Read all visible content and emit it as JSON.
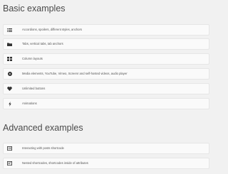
{
  "colors": {
    "background": "#f1f1f1",
    "item_background": "#fafafa",
    "item_border": "#e6e6e6",
    "icon": "#333333",
    "text": "#555555"
  },
  "basic": {
    "title": "Basic examples",
    "items": [
      {
        "label": "Accordions, spoilers, different styles, anchors",
        "icon": "list-icon"
      },
      {
        "label": "Tabs, vertical tabs, tab anchors",
        "icon": "folder-icon"
      },
      {
        "label": "Column layouts",
        "icon": "grid-icon"
      },
      {
        "label": "Media elements, YouTube, Vimeo, Screenr and self-hosted videos, audio player",
        "icon": "play-circle-icon"
      },
      {
        "label": "Unlimited buttons",
        "icon": "heart-icon"
      },
      {
        "label": "Animations",
        "icon": "bolt-icon"
      }
    ]
  },
  "advanced": {
    "title": "Advanced examples",
    "items": [
      {
        "label": "Interacting with posts shortcode",
        "icon": "list-alt-icon"
      },
      {
        "label": "Nested shortcodes, shortcodes inside of attributes",
        "icon": "code-list-icon"
      }
    ]
  }
}
